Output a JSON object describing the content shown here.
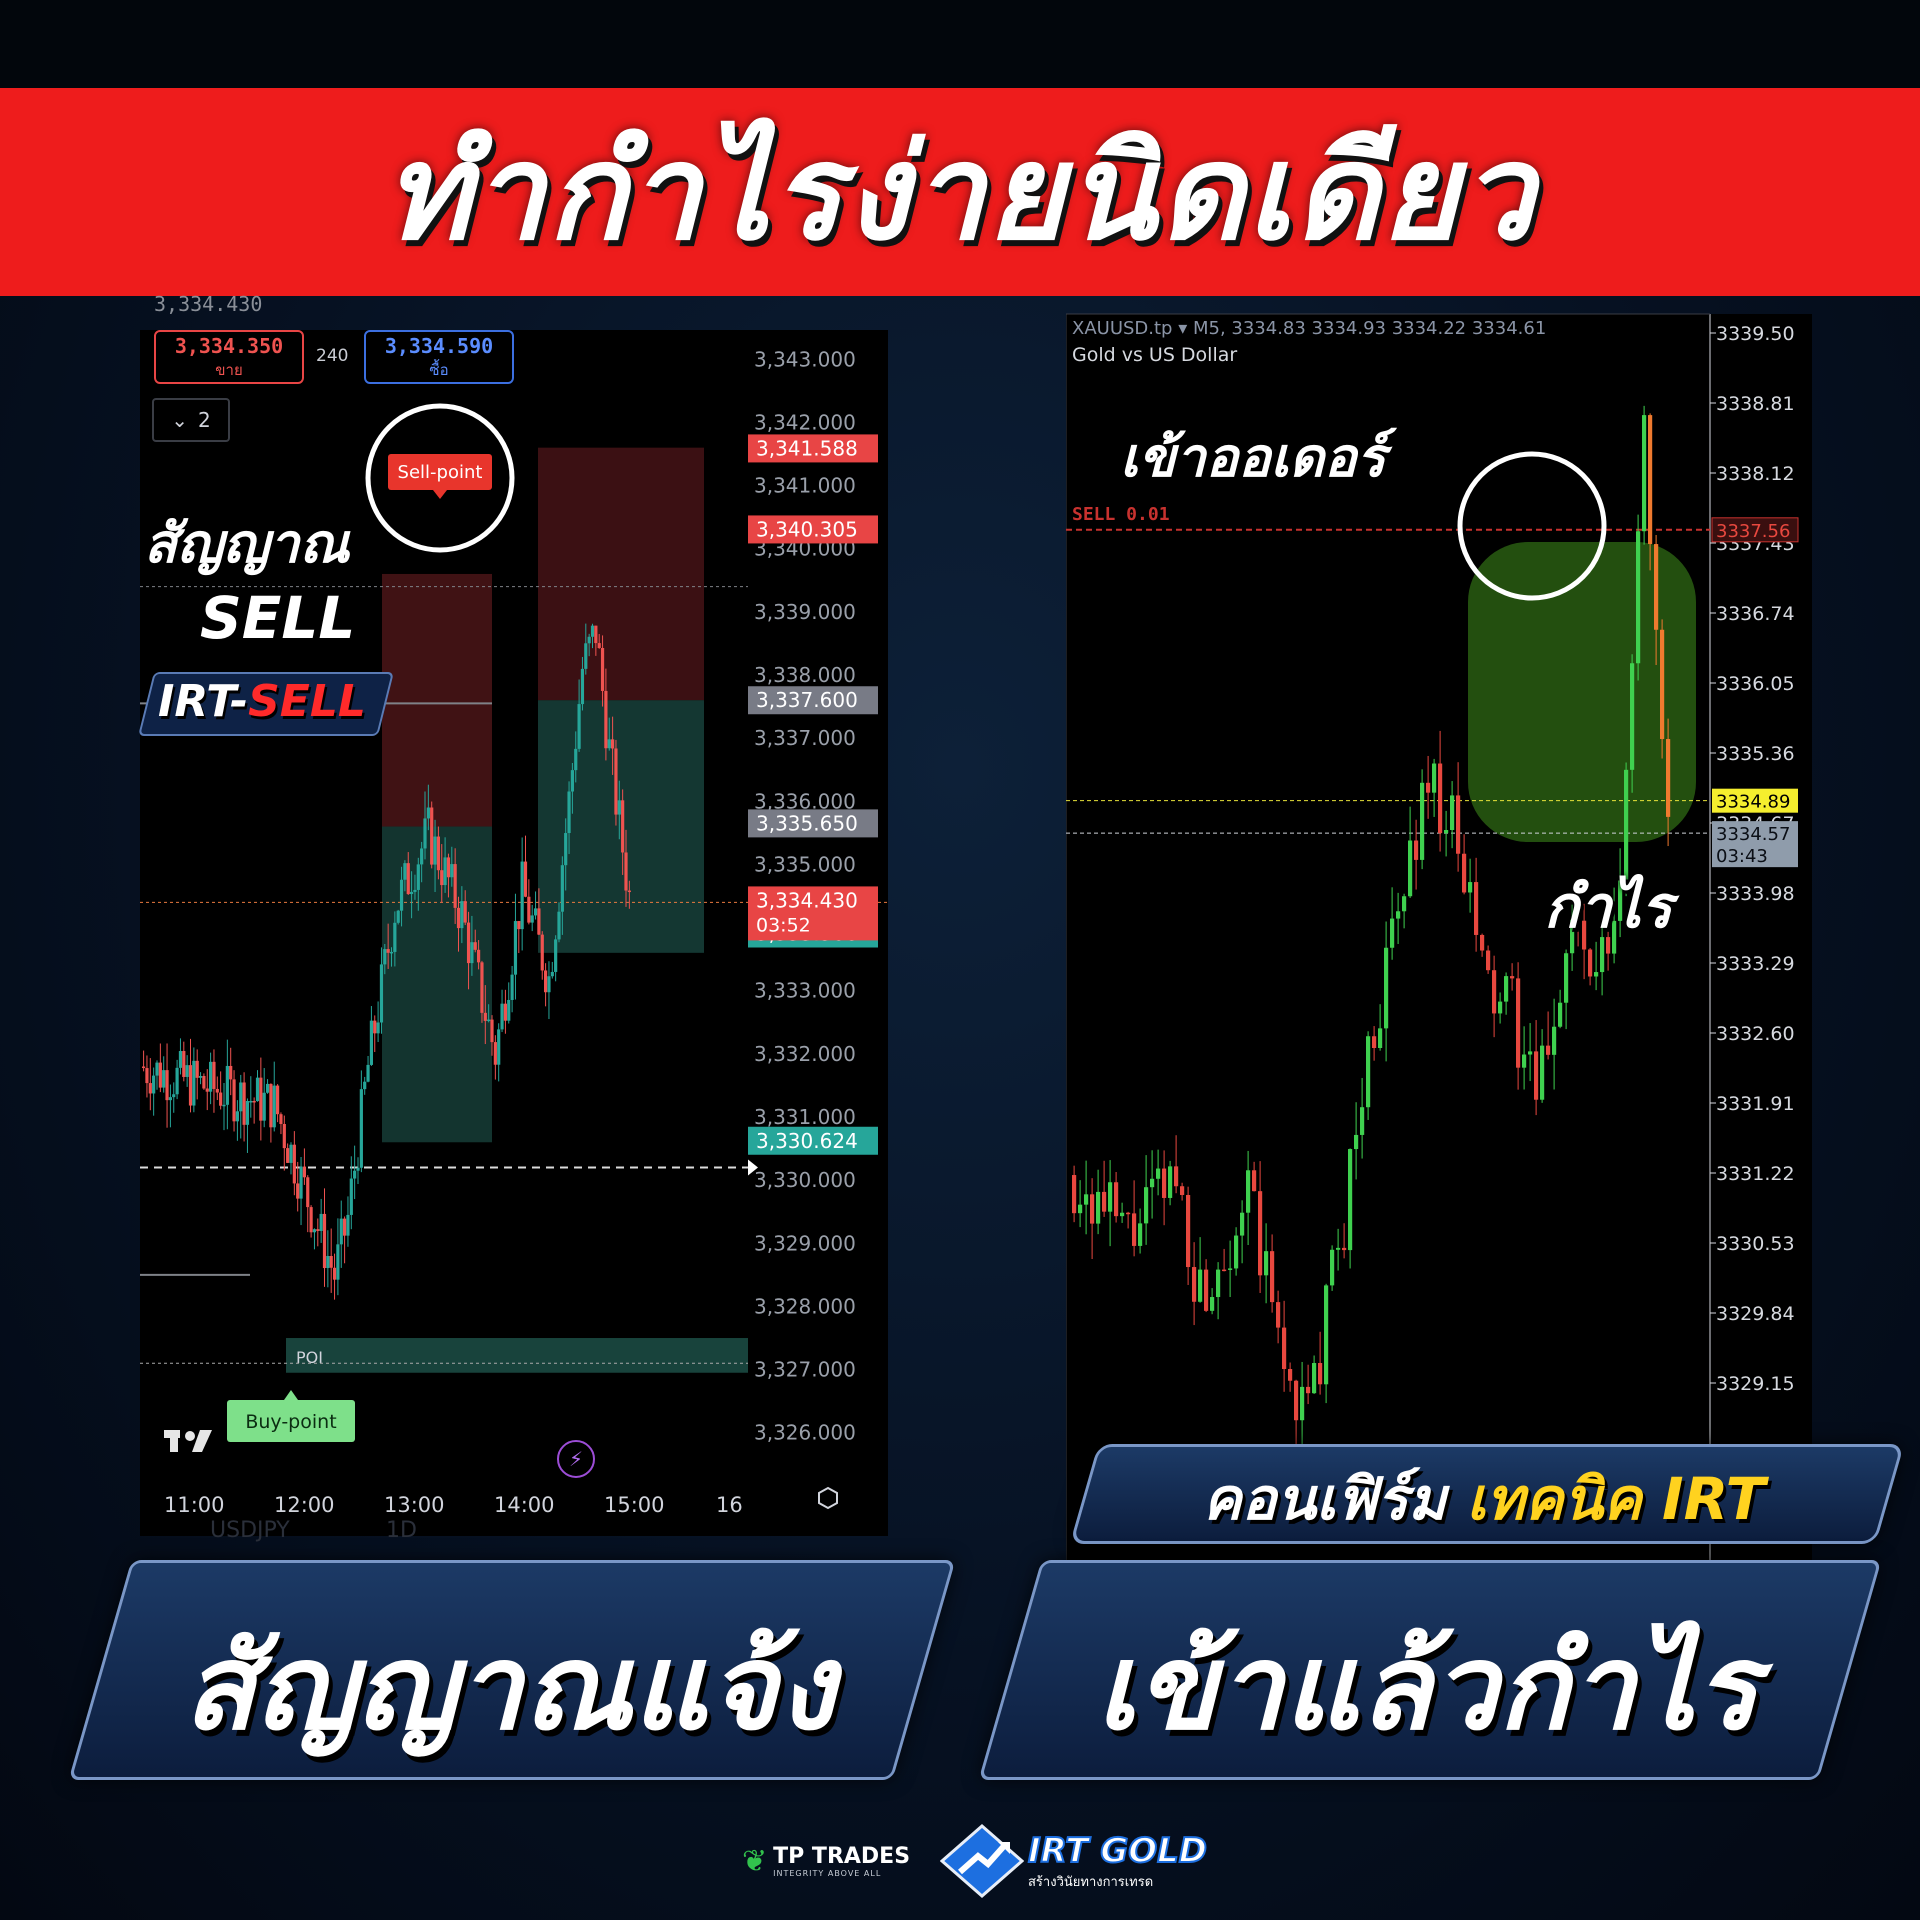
{
  "banner": {
    "title": "ทำกำไรง่ายนิดเดียว"
  },
  "left_chart": {
    "top_price": "3,334.430",
    "sell_price": "3,334.350",
    "sell_label": "ขาย",
    "spread": "240",
    "buy_price": "3,334.590",
    "buy_label": "ซื้อ",
    "dropdown_value": "2",
    "y_ticks": [
      "3,343.000",
      "3,342.000",
      "3,341.000",
      "3,340.000",
      "3,339.000",
      "3,338.000",
      "3,337.000",
      "3,336.000",
      "3,335.000",
      "3,334.000",
      "3,333.000",
      "3,332.000",
      "3,331.000",
      "3,330.000",
      "3,329.000",
      "3,328.000",
      "3,327.000",
      "3,326.000"
    ],
    "price_badges": {
      "b1": "3,341.588",
      "b2": "3,340.305",
      "b3": "3,337.600",
      "b4": "3,335.650",
      "b5": "3,334.430",
      "b5_time": "03:52",
      "b6": "3,333.906",
      "b7": "3,330.624"
    },
    "x_ticks": [
      "11:00",
      "12:00",
      "13:00",
      "14:00",
      "15:00",
      "16"
    ],
    "sell_point_label": "Sell-point",
    "buy_point_label": "Buy-point",
    "poi_label": "POI",
    "bottom_symbol": "USDJPY",
    "bottom_tf": "1D",
    "colors": {
      "up": "#26a69a",
      "down": "#ef5350",
      "badge_red": "#e84545",
      "badge_green": "#26a69a",
      "badge_gray": "#787b86"
    },
    "icons": [
      "tradingview-logo-icon",
      "lightning-icon",
      "settings-hex-icon",
      "chevron-down-icon"
    ]
  },
  "left_overlay": {
    "signal_label": "สัญญาณ",
    "sell_label": "SELL",
    "tag_prefix": "IRT-",
    "tag_suffix": "SELL"
  },
  "right_chart": {
    "symbol_line": "XAUUSD.tp ▾ M5, 3334.83 3334.93 3334.22 3334.61",
    "symbol_desc": "Gold vs US Dollar",
    "y_ticks": [
      "3339.50",
      "3338.81",
      "3338.12",
      "3337.43",
      "3336.74",
      "3336.05",
      "3335.36",
      "3334.67",
      "3333.98",
      "3333.29",
      "3332.60",
      "3331.91",
      "3331.22",
      "3330.53",
      "3329.84",
      "3329.15"
    ],
    "sell_order_label": "SELL 0.01",
    "sell_order_price": "3337.56",
    "current_price": "3334.89",
    "bid_price": "3334.57",
    "bid_time": "03:43",
    "colors": {
      "up": "#3fd14f",
      "down": "#e8483f",
      "profit_zone": "#3f8f1c"
    }
  },
  "right_overlay": {
    "entry_label": "เข้าออเดอร์",
    "profit_label": "กำไร"
  },
  "confirm": {
    "prefix": "คอนเฟิร์ม",
    "highlight": "เทคนิค IRT",
    "highlight_color": "#ffd21f"
  },
  "bottom_left": {
    "text": "สัญญาณแจ้ง"
  },
  "bottom_right": {
    "text": "เข้าแล้วกำไร"
  },
  "footer": {
    "tp_name": "TP TRADES",
    "tp_tagline": "INTEGRITY ABOVE ALL",
    "irt_name": "IRT GOLD",
    "irt_tagline": "สร้างวินัยทางการเทรด"
  }
}
